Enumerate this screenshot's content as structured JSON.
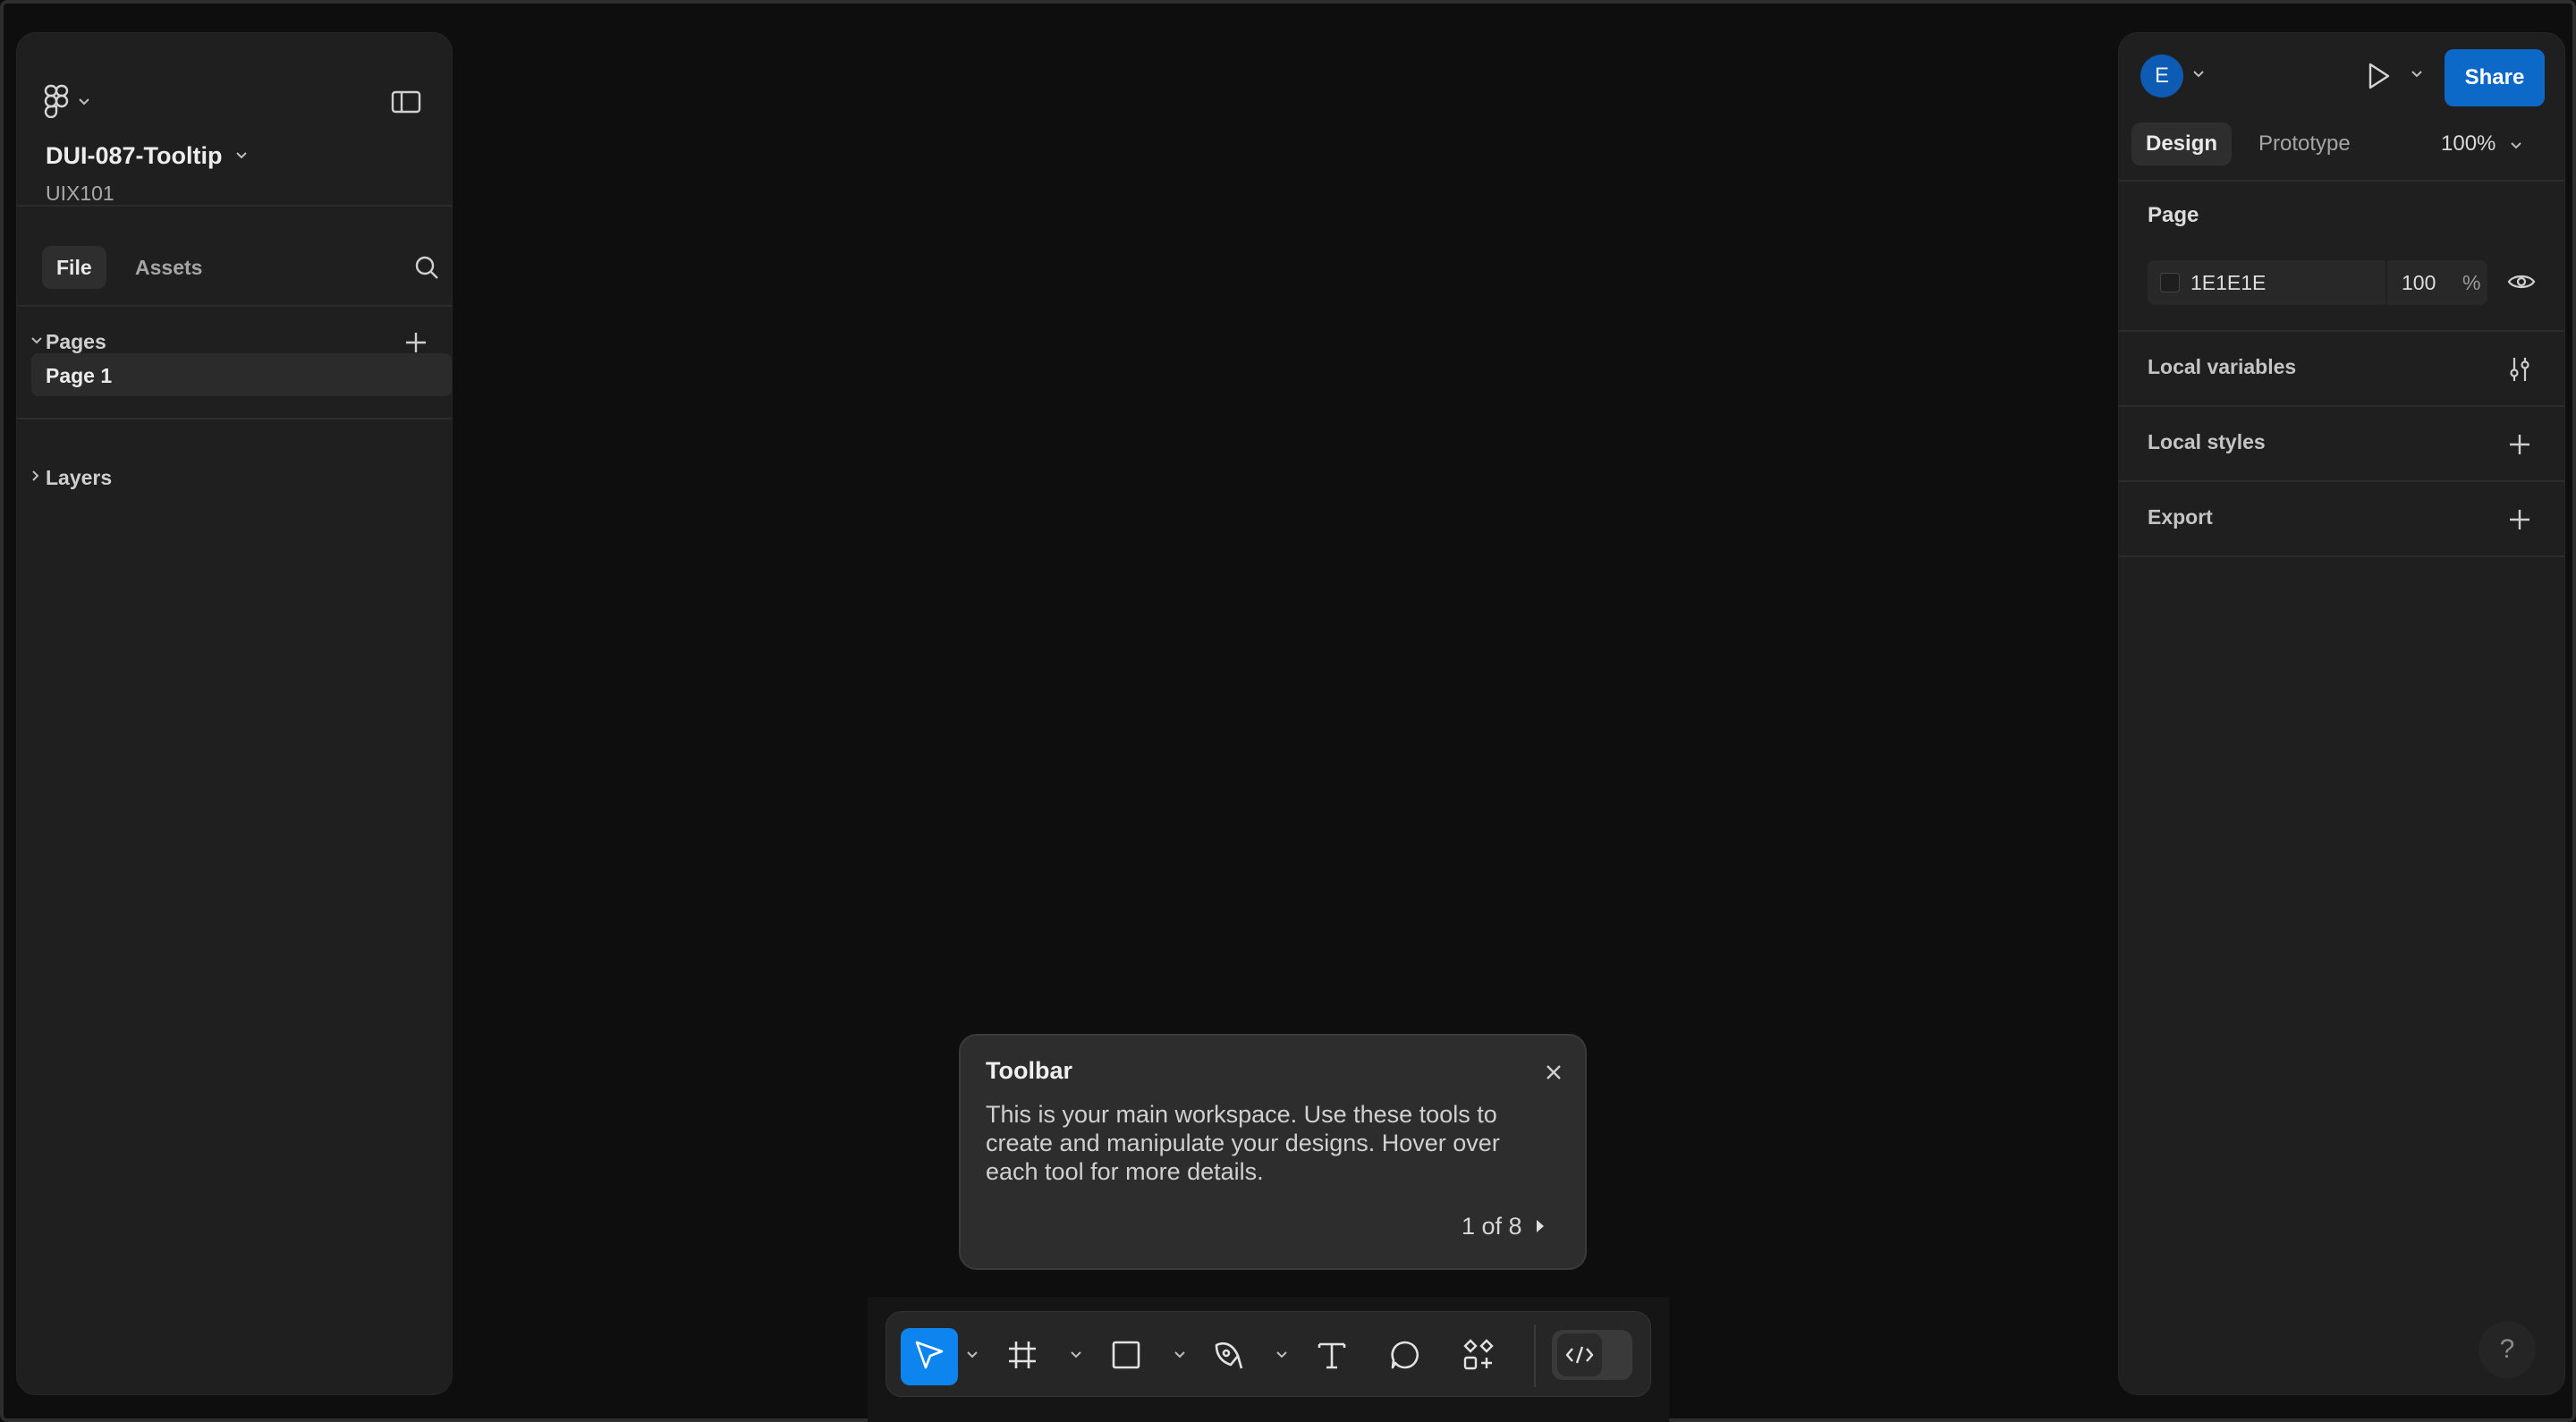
{
  "file": {
    "title": "DUI-087-Tooltip",
    "project": "UIX101"
  },
  "left_panel": {
    "tabs": [
      {
        "label": "File",
        "active": true
      },
      {
        "label": "Assets",
        "active": false
      }
    ],
    "pages_label": "Pages",
    "pages": [
      {
        "label": "Page 1",
        "selected": true
      }
    ],
    "layers_label": "Layers"
  },
  "right_panel": {
    "avatar_initial": "E",
    "share_label": "Share",
    "tabs": [
      {
        "label": "Design",
        "active": true
      },
      {
        "label": "Prototype",
        "active": false
      }
    ],
    "zoom": "100%",
    "page_section": {
      "title": "Page",
      "background_hex": "1E1E1E",
      "opacity": "100",
      "percent_sign": "%"
    },
    "rows": [
      {
        "label": "Local variables",
        "icon": "sliders-icon"
      },
      {
        "label": "Local styles",
        "icon": "plus-icon"
      },
      {
        "label": "Export",
        "icon": "plus-icon"
      }
    ],
    "help_label": "?"
  },
  "tooltip": {
    "title": "Toolbar",
    "body": "This is your main workspace. Use these tools to create and manipulate your designs. Hover over each tool for more details.",
    "step": "1 of 8"
  },
  "toolbar": {
    "tools": [
      {
        "name": "move-tool",
        "icon": "cursor-icon",
        "active": true
      },
      {
        "name": "frame-tool",
        "icon": "frame-icon",
        "active": false
      },
      {
        "name": "shape-tool",
        "icon": "rectangle-icon",
        "active": false
      },
      {
        "name": "pen-tool",
        "icon": "pen-icon",
        "active": false
      },
      {
        "name": "text-tool",
        "icon": "text-icon",
        "active": false
      },
      {
        "name": "comment-tool",
        "icon": "comment-icon",
        "active": false
      },
      {
        "name": "actions-tool",
        "icon": "components-icon",
        "active": false
      }
    ],
    "dev_mode_icon": "code-icon"
  },
  "colors": {
    "accent": "#0d84ee",
    "share": "#0c69c8",
    "avatar": "#0d5bb3",
    "canvas": "#0e0e0e",
    "panel": "#1f1f1f"
  }
}
